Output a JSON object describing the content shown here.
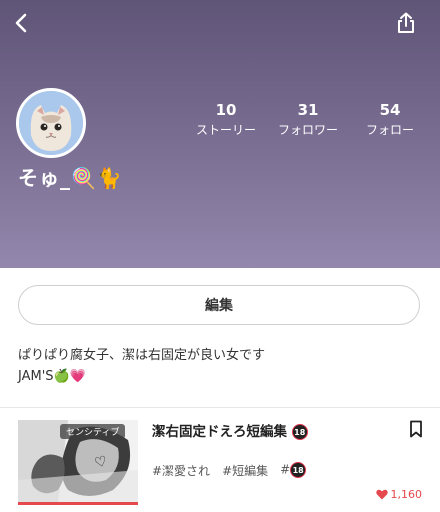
{
  "profile": {
    "username": "そゅ_🍭🐈",
    "stats": [
      {
        "value": "10",
        "label": "ストーリー"
      },
      {
        "value": "31",
        "label": "フォロワー"
      },
      {
        "value": "54",
        "label": "フォロー"
      }
    ]
  },
  "actions": {
    "edit_label": "編集"
  },
  "bio": {
    "line1": "ぱりぱり腐女子、潔は右固定が良い女です",
    "line2": "JAM'S🍏💗"
  },
  "story": {
    "title": "潔右固定ドえろ短編集",
    "badge": "センシティブ",
    "tags": [
      "#潔愛され",
      "#短編集",
      "#"
    ],
    "rating_badge": "18",
    "likes": "1,160"
  },
  "colors": {
    "header_top": "#5f5577",
    "header_bottom": "#9487ad",
    "like": "#e5484d"
  },
  "icons": {
    "back": "chevron-left-icon",
    "share": "share-icon",
    "bookmark": "bookmark-icon",
    "heart": "heart-icon"
  }
}
